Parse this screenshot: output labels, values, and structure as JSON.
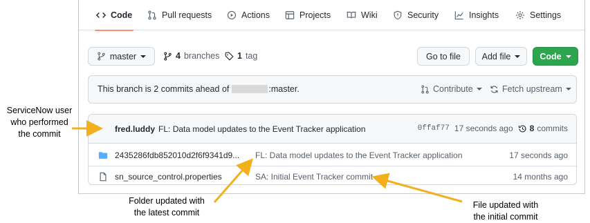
{
  "tabs": [
    {
      "label": "Code",
      "icon": "code-icon"
    },
    {
      "label": "Pull requests",
      "icon": "pull-request-icon"
    },
    {
      "label": "Actions",
      "icon": "play-icon"
    },
    {
      "label": "Projects",
      "icon": "table-icon"
    },
    {
      "label": "Wiki",
      "icon": "book-icon"
    },
    {
      "label": "Security",
      "icon": "shield-icon"
    },
    {
      "label": "Insights",
      "icon": "graph-icon"
    },
    {
      "label": "Settings",
      "icon": "gear-icon"
    }
  ],
  "toolbar": {
    "branch": "master",
    "branches_count": "4",
    "branches_label": "branches",
    "tags_count": "1",
    "tags_label": "tag",
    "go_to_file": "Go to file",
    "add_file": "Add file",
    "code": "Code"
  },
  "banner": {
    "text_before": "This branch is 2 commits ahead of",
    "text_after": ":master.",
    "contribute": "Contribute",
    "fetch_upstream": "Fetch upstream"
  },
  "latest_commit": {
    "author": "fred.luddy",
    "message": "FL: Data model updates to the Event Tracker application",
    "sha": "0ffaf77",
    "age": "17 seconds ago",
    "commits_count": "8",
    "commits_label": "commits"
  },
  "files": [
    {
      "type": "folder",
      "name": "2435286fdb852010d2f6f9341d9...",
      "message": "FL: Data model updates to the Event Tracker application",
      "age": "17 seconds ago"
    },
    {
      "type": "file",
      "name": "sn_source_control.properties",
      "message": "SA: Initial Event Tracker commit",
      "age": "14 months ago"
    }
  ],
  "annotations": {
    "user": [
      "ServiceNow user",
      "who performed",
      "the commit"
    ],
    "folder": [
      "Folder updated with",
      "the latest commit"
    ],
    "file": [
      "File updated with",
      "the initial commit"
    ]
  },
  "colors": {
    "arrow": "#f2b01e",
    "active_tab_underline": "#fd8c73",
    "primary_button": "#2da44e",
    "folder_icon": "#54aeff"
  }
}
